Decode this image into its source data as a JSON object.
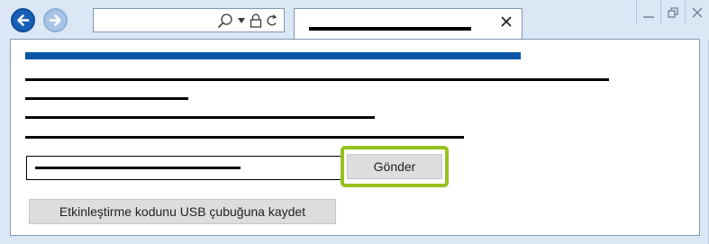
{
  "browser": {
    "nav": {
      "back_icon": "arrow-left-icon",
      "forward_icon": "arrow-right-icon"
    },
    "address_bar": {
      "icons": [
        "search-icon",
        "dropdown-arrow-icon",
        "lock-icon",
        "refresh-icon"
      ]
    },
    "tab": {
      "close_glyph": "✕"
    },
    "window_controls": [
      "minimize-icon",
      "restore-icon",
      "close-icon"
    ],
    "colors": {
      "frame": "#dbe7f5",
      "back_button": "#1760b8",
      "forward_button": "#a9c4e4"
    }
  },
  "page": {
    "header_color": "#0a56a6",
    "submit_button": {
      "label": "Gönder",
      "highlight_color": "#95c11f"
    },
    "save_usb_button": {
      "label": "Etkinleştirme kodunu USB çubuğuna kaydet"
    }
  }
}
